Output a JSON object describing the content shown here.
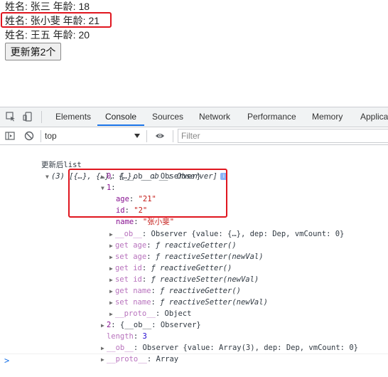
{
  "page": {
    "people": [
      {
        "text": "姓名: 张三 年龄: 18"
      },
      {
        "text": "姓名: 张小斐 年龄: 21"
      },
      {
        "text": "姓名: 王五 年龄: 20"
      }
    ],
    "update_button": "更新第2个"
  },
  "devtools": {
    "tabs": [
      "Elements",
      "Console",
      "Sources",
      "Network",
      "Performance",
      "Memory",
      "Applica"
    ],
    "active_tab": "Console",
    "context": "top",
    "filter_placeholder": "Filter",
    "console": {
      "log_label": "更新后list",
      "summary": "(3) [{…}, {…}, {…}, __ob__: Observer]",
      "item0_key": "0",
      "item0_val": "{__ob__: Observer}",
      "item1_key": "1",
      "age_key": "age",
      "age_val": "\"21\"",
      "id_key": "id",
      "id_val": "\"2\"",
      "name_key": "name",
      "name_val": "\"张小斐\"",
      "ob_key": "__ob__",
      "ob_val": "Observer {value: {…}, dep: Dep, vmCount: 0}",
      "get_age": "get age",
      "set_age": "set age",
      "get_id": "get id",
      "set_id": "set id",
      "get_name": "get name",
      "set_name": "set name",
      "getter_fn": "ƒ reactiveGetter()",
      "setter_fn": "ƒ reactiveSetter(newVal)",
      "proto_key": "__proto__",
      "proto_obj": "Object",
      "item2_key": "2",
      "item2_val": "{__ob__: Observer}",
      "length_key": "length",
      "length_val": "3",
      "arr_ob_val": "Observer {value: Array(3), dep: Dep, vmCount: 0}",
      "proto_arr": "Array",
      "prompt": ">"
    }
  },
  "colors": {
    "highlight": "#e0161f",
    "accent": "#1a73e8",
    "key_purple": "#881391",
    "string_red": "#c41a16",
    "number_blue": "#1c00cf"
  },
  "icons": [
    "inspect-element-icon",
    "device-toolbar-icon",
    "sidebar-toggle-icon",
    "clear-console-icon",
    "eye-icon",
    "info-icon",
    "expand-triangle-icon",
    "collapse-triangle-icon"
  ]
}
